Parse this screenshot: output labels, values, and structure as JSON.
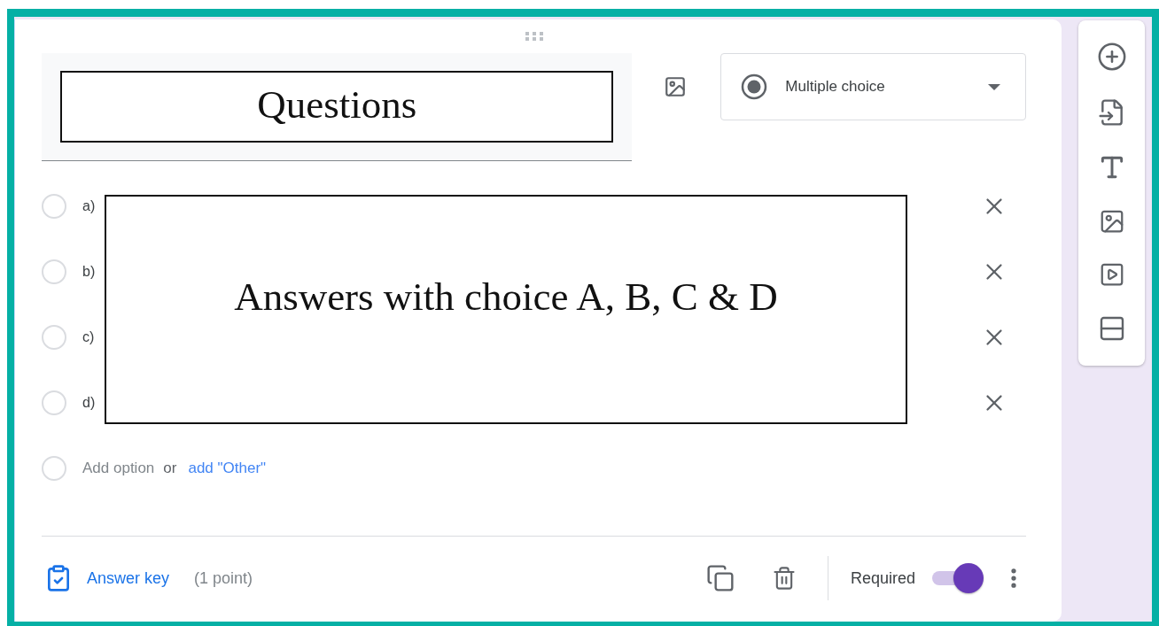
{
  "question": {
    "title": "Questions",
    "type": "Multiple choice"
  },
  "options": [
    {
      "label": "a)",
      "selected": false
    },
    {
      "label": "b)",
      "selected": false
    },
    {
      "label": "c)",
      "selected": false
    },
    {
      "label": "d)",
      "selected": false
    }
  ],
  "answers_note": "Answers with choice A, B, C & D",
  "add_option": {
    "selected": false,
    "label": "Add option",
    "separator": "or",
    "other_link": "add \"Other\""
  },
  "footer": {
    "answer_key": "Answer key",
    "points": "(1 point)",
    "required_label": "Required",
    "required_on": true
  }
}
